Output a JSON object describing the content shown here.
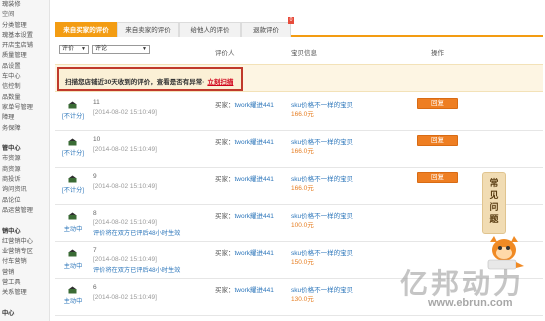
{
  "sidebar": {
    "items": [
      {
        "label": "瑰装修",
        "section": false
      },
      {
        "label": "空间",
        "section": false
      },
      {
        "label": "分类管理",
        "section": false
      },
      {
        "label": "瑰基本设置",
        "section": false
      },
      {
        "label": "开店宝店铺",
        "section": false
      },
      {
        "label": "质量管理",
        "section": false
      },
      {
        "label": "品设置",
        "section": false
      },
      {
        "label": "车中心",
        "section": false
      },
      {
        "label": "信控制",
        "section": false
      },
      {
        "label": "品数量",
        "section": false
      },
      {
        "label": "家单号管理",
        "section": false
      },
      {
        "label": "障理",
        "section": false
      },
      {
        "label": "务保障",
        "section": false
      },
      {
        "label": "",
        "section": false
      },
      {
        "label": "管中心",
        "section": true
      },
      {
        "label": "市资源",
        "section": false
      },
      {
        "label": "商资源",
        "section": false
      },
      {
        "label": "商投诉",
        "section": false
      },
      {
        "label": "询问资讯",
        "section": false
      },
      {
        "label": "品论位",
        "section": false
      },
      {
        "label": "品运营管理",
        "section": false
      },
      {
        "label": "",
        "section": false
      },
      {
        "label": "销中心",
        "section": true
      },
      {
        "label": "红营销中心",
        "section": false
      },
      {
        "label": "业营销专区",
        "section": false
      },
      {
        "label": "付车营销",
        "section": false
      },
      {
        "label": "营销",
        "section": false
      },
      {
        "label": "营工具",
        "section": false
      },
      {
        "label": "关系管理",
        "section": false
      },
      {
        "label": "",
        "section": false
      },
      {
        "label": "中心",
        "section": true
      }
    ]
  },
  "tabs": [
    {
      "label": "来自买家的评价"
    },
    {
      "label": "来自卖家的评价"
    },
    {
      "label": "给他人的评价"
    },
    {
      "label": "退款评价",
      "badge": "0"
    }
  ],
  "filters": {
    "rating": "评价",
    "comment": "评论",
    "col_rater": "评价人",
    "col_item": "宝贝信息",
    "col_action": "操作"
  },
  "notice": {
    "text": "扫描您店铺近30天收到的评价，查看是否有异常·",
    "link": "立刻扫描"
  },
  "reviews": [
    {
      "rate": "[不计分]",
      "num": "11",
      "date": "[2014-08-02 15:10:49]",
      "warn": "",
      "buyer_label": "买家：",
      "buyer": "twork耀进441",
      "item": "sku价格不一样的宝贝",
      "price": "166.0元",
      "reply": "回复"
    },
    {
      "rate": "[不计分]",
      "num": "10",
      "date": "[2014-08-02 15:10:49]",
      "warn": "",
      "buyer_label": "买家：",
      "buyer": "twork耀进441",
      "item": "sku价格不一样的宝贝",
      "price": "166.0元",
      "reply": "回复"
    },
    {
      "rate": "[不计分]",
      "num": "9",
      "date": "[2014-08-02 15:10:49]",
      "warn": "",
      "buyer_label": "买家：",
      "buyer": "twork耀进441",
      "item": "sku价格不一样的宝贝",
      "price": "166.0元",
      "reply": "回复"
    },
    {
      "rate": "主动中",
      "num": "8",
      "date": "[2014-08-02 15:10:49]",
      "warn": "评价将在双方已评后48小时生效",
      "buyer_label": "买家：",
      "buyer": "twork耀进441",
      "item": "sku价格不一样的宝贝",
      "price": "100.0元",
      "reply": ""
    },
    {
      "rate": "主动中",
      "num": "7",
      "date": "[2014-08-02 15:10:49]",
      "warn": "评价将在双方已评后48小时生效",
      "buyer_label": "买家：",
      "buyer": "twork耀进441",
      "item": "sku价格不一样的宝贝",
      "price": "150.0元",
      "reply": ""
    },
    {
      "rate": "主动中",
      "num": "6",
      "date": "[2014-08-02 15:10:49]",
      "warn": "",
      "buyer_label": "买家：",
      "buyer": "twork耀进441",
      "item": "sku价格不一样的宝贝",
      "price": "130.0元",
      "reply": ""
    }
  ],
  "help": {
    "text": "常见问题"
  },
  "watermark": {
    "brand": "亿邦动力",
    "url": "www.ebrun.com"
  },
  "colors": {
    "accent": "#f39c12",
    "button": "#ee7e22",
    "link": "#2e77bb",
    "alert": "#c0392b"
  }
}
